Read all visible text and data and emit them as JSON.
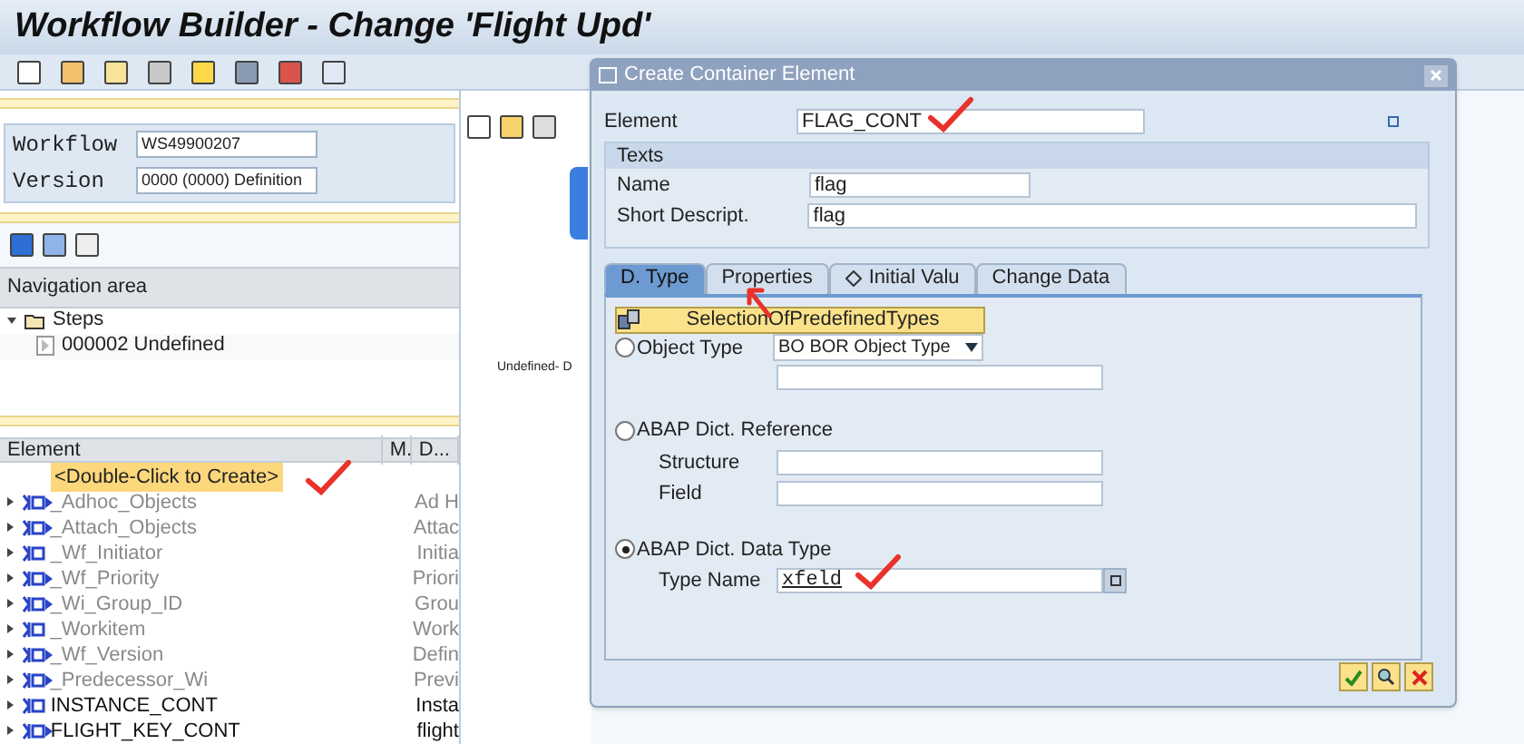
{
  "window": {
    "title": "Workflow Builder - Change 'Flight Upd'"
  },
  "workflow_panel": {
    "fields": [
      {
        "label": "Workflow",
        "value": "WS49900207"
      },
      {
        "label": "Version",
        "value": "0000 (0000) Definition"
      }
    ]
  },
  "navigation": {
    "title": "Navigation area",
    "items": [
      {
        "label": "Steps",
        "expanded": true,
        "children": [
          {
            "label": "000002 Undefined"
          }
        ]
      }
    ]
  },
  "elements": {
    "columns": [
      "Element",
      "M.",
      "D..."
    ],
    "create_hint": "<Double-Click to Create>",
    "rows": [
      {
        "name": "_Adhoc_Objects",
        "description": "Ad H",
        "disabled": true
      },
      {
        "name": "_Attach_Objects",
        "description": "Attac",
        "disabled": true
      },
      {
        "name": "_Wf_Initiator",
        "description": "Initia",
        "disabled": true
      },
      {
        "name": "_Wf_Priority",
        "description": "Priori",
        "disabled": true
      },
      {
        "name": "_Wi_Group_ID",
        "description": "Grou",
        "disabled": true
      },
      {
        "name": "_Workitem",
        "description": "Work",
        "disabled": true
      },
      {
        "name": "_Wf_Version",
        "description": "Defin",
        "disabled": true
      },
      {
        "name": "_Predecessor_Wi",
        "description": "Previ",
        "disabled": true
      },
      {
        "name": "INSTANCE_CONT",
        "description": "Insta",
        "disabled": false
      },
      {
        "name": "FLIGHT_KEY_CONT",
        "description": "flight",
        "disabled": false
      }
    ]
  },
  "canvas": {
    "label": "Undefined- D"
  },
  "dialog": {
    "title": "Create Container Element",
    "element": {
      "label": "Element",
      "value": "FLAG_CONT"
    },
    "texts": {
      "title": "Texts",
      "fields": [
        {
          "label": "Name",
          "value": "flag"
        },
        {
          "label": "Short Descript.",
          "value": "flag"
        }
      ]
    },
    "tabs": [
      {
        "label": "D. Type",
        "selected": true
      },
      {
        "label": "Properties",
        "selected": false
      },
      {
        "label": "Initial Valu",
        "selected": false
      },
      {
        "label": "Change Data",
        "selected": false
      }
    ],
    "predefined_button": "SelectionOfPredefinedTypes",
    "options": [
      {
        "label": "Object Type",
        "selected": false,
        "dropdown": "BO BOR Object Type",
        "blank_input": true
      },
      {
        "label": "ABAP Dict. Reference",
        "selected": false,
        "fields": [
          {
            "label": "Structure"
          },
          {
            "label": "Field"
          }
        ]
      },
      {
        "label": "ABAP Dict. Data Type",
        "selected": true,
        "fields": [
          {
            "label": "Type Name",
            "value": "xfeld"
          }
        ]
      }
    ]
  }
}
